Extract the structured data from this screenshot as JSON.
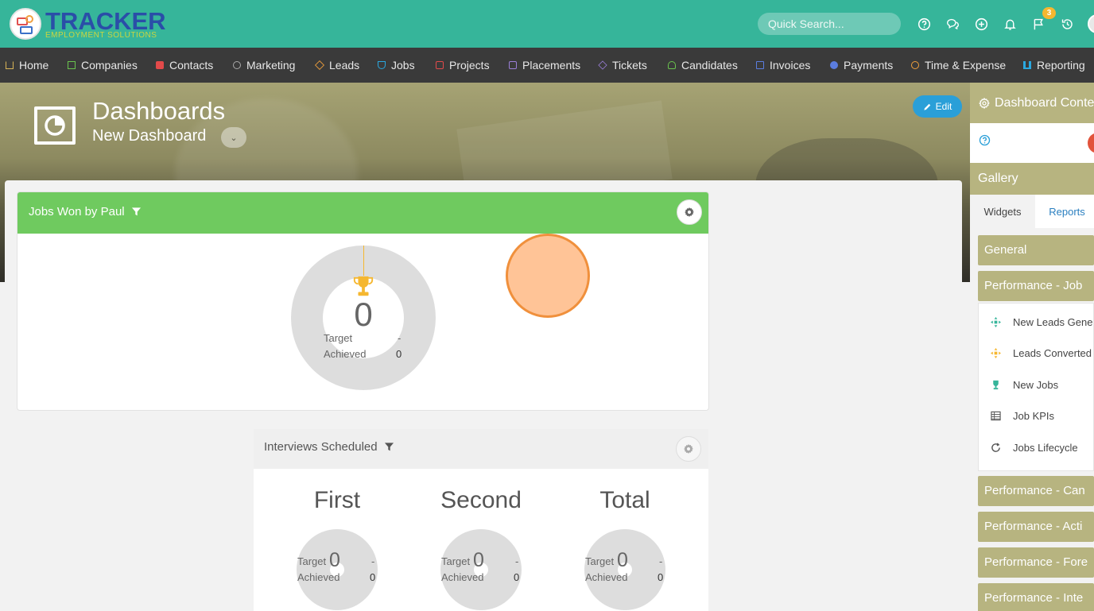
{
  "brand": {
    "name": "TRACKER",
    "tagline": "EMPLOYMENT SOLUTIONS"
  },
  "search": {
    "placeholder": "Quick Search..."
  },
  "notifications": {
    "flag_count": "3"
  },
  "nav": [
    {
      "label": "Home",
      "icon": "home-icon"
    },
    {
      "label": "Companies",
      "icon": "building-icon"
    },
    {
      "label": "Contacts",
      "icon": "contact-card-icon"
    },
    {
      "label": "Marketing",
      "icon": "broadcast-icon"
    },
    {
      "label": "Leads",
      "icon": "diamond-icon"
    },
    {
      "label": "Jobs",
      "icon": "trophy-icon"
    },
    {
      "label": "Projects",
      "icon": "checkbox-icon"
    },
    {
      "label": "Placements",
      "icon": "briefcase-icon"
    },
    {
      "label": "Tickets",
      "icon": "tag-icon"
    },
    {
      "label": "Candidates",
      "icon": "people-icon"
    },
    {
      "label": "Invoices",
      "icon": "invoice-icon"
    },
    {
      "label": "Payments",
      "icon": "payment-icon"
    },
    {
      "label": "Time & Expense",
      "icon": "clock-icon"
    },
    {
      "label": "Reporting",
      "icon": "bar-chart-icon"
    }
  ],
  "header": {
    "title": "Dashboards",
    "subtitle": "New Dashboard",
    "edit_label": "Edit"
  },
  "widget_jobs": {
    "title": "Jobs Won by Paul",
    "value": "0",
    "target_label": "Target",
    "target_value": "-",
    "achieved_label": "Achieved",
    "achieved_value": "0"
  },
  "widget_interviews": {
    "title": "Interviews Scheduled",
    "columns": [
      {
        "heading": "First",
        "value": "0",
        "target_label": "Target",
        "target_value": "-",
        "achieved_label": "Achieved",
        "achieved_value": "0"
      },
      {
        "heading": "Second",
        "value": "0",
        "target_label": "Target",
        "target_value": "-",
        "achieved_label": "Achieved",
        "achieved_value": "0"
      },
      {
        "heading": "Total",
        "value": "0",
        "target_label": "Target",
        "target_value": "-",
        "achieved_label": "Achieved",
        "achieved_value": "0"
      }
    ]
  },
  "panel": {
    "title": "Dashboard Conte",
    "gallery_label": "Gallery",
    "tabs": [
      "Widgets",
      "Reports"
    ],
    "categories": [
      "General",
      "Performance - Job",
      "Performance - Can",
      "Performance - Acti",
      "Performance - Fore",
      "Performance - Inte"
    ],
    "items": [
      {
        "label": "New Leads Gene",
        "icon": "plus-cross-icon"
      },
      {
        "label": "Leads Converted",
        "icon": "plus-cross-icon"
      },
      {
        "label": "New Jobs",
        "icon": "trophy-icon"
      },
      {
        "label": "Job KPIs",
        "icon": "table-icon"
      },
      {
        "label": "Jobs Lifecycle",
        "icon": "cycle-icon"
      }
    ]
  },
  "colors": {
    "topbar": "#36b59a",
    "navbar": "#3a3a3a",
    "widget_header": "#6fca5f",
    "panel_olive": "#b7b480",
    "edit_button": "#2a9fd8",
    "badge": "#f5b730"
  }
}
